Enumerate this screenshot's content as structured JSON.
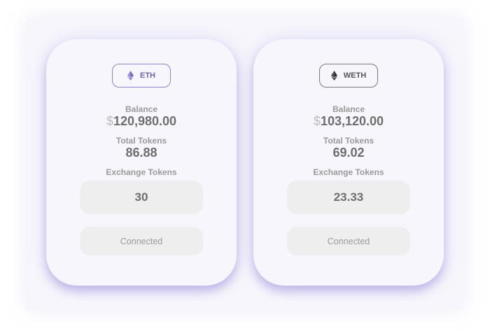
{
  "cards": [
    {
      "token": "ETH",
      "token_icon": "ethereum-icon",
      "accent_color": "#8c86c6",
      "balance_label": "Balance",
      "currency_symbol": "$",
      "balance_value": "120,980.00",
      "total_tokens_label": "Total Tokens",
      "total_tokens_value": "86.88",
      "exchange_label": "Exchange Tokens",
      "exchange_value": "30",
      "button_label": "Connected"
    },
    {
      "token": "WETH",
      "token_icon": "ethereum-icon",
      "accent_color": "#7a7a7a",
      "balance_label": "Balance",
      "currency_symbol": "$",
      "balance_value": "103,120.00",
      "total_tokens_label": "Total Tokens",
      "total_tokens_value": "69.02",
      "exchange_label": "Exchange Tokens",
      "exchange_value": "23.33",
      "button_label": "Connected"
    }
  ]
}
